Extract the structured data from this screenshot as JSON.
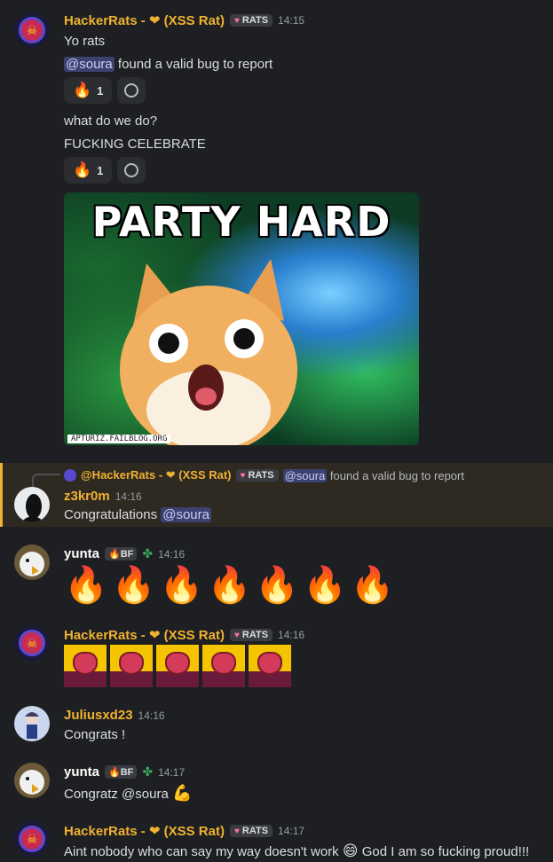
{
  "messages": {
    "m1": {
      "author": "HackerRats - ❤ (XSS Rat)",
      "tag": "RATS",
      "time": "14:15",
      "line1": "Yo rats",
      "mention": "@soura",
      "line2_rest": " found a valid bug to report",
      "reaction1_emoji": "🔥",
      "reaction1_count": "1",
      "line3": "what do we do?",
      "line4": "FUCKING CELEBRATE",
      "reaction2_emoji": "🔥",
      "reaction2_count": "1",
      "gif_title": "PARTY HARD",
      "gif_url": "APTURIZ.FAILBLOG.ORG"
    },
    "reply": {
      "ref_author": "@HackerRats - ❤ (XSS Rat)",
      "ref_tag": "RATS",
      "ref_mention": "@soura",
      "ref_text": " found a valid bug to report"
    },
    "m2": {
      "author": "z3kr0m",
      "time": "14:16",
      "text": "Congratulations ",
      "mention": "@soura"
    },
    "m3": {
      "author": "yunta",
      "badge": "BF",
      "time": "14:16",
      "emoji": "🔥",
      "emoji_count": 7
    },
    "m4": {
      "author": "HackerRats - ❤ (XSS Rat)",
      "tag": "RATS",
      "time": "14:16"
    },
    "m5": {
      "author": "Juliusxd23",
      "time": "14:16",
      "text": "Congrats !"
    },
    "m6": {
      "author": "yunta",
      "badge": "BF",
      "time": "14:17",
      "text": "Congratz @soura ",
      "emoji": "💪"
    },
    "m7": {
      "author": "HackerRats - ❤ (XSS Rat)",
      "tag": "RATS",
      "time": "14:17",
      "text_a": "Aint nobody who can say my way doesn't work ",
      "emoji": "😄",
      "text_b": " God I am so fucking proud!!!"
    }
  },
  "colors": {
    "background": "#1e1f22",
    "author_gold": "#f0b232",
    "mention_bg": "#3c4270",
    "highlight_border": "#f0b232"
  }
}
